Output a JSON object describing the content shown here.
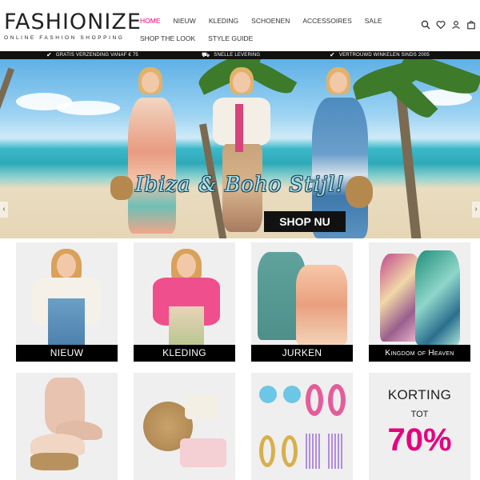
{
  "header": {
    "logo_main": "FASHIONIZE",
    "logo_sub": "ONLINE FASHION SHOPPING",
    "nav_row1": [
      "HOME",
      "NIEUW",
      "KLEDING",
      "SCHOENEN",
      "ACCESSOIRES",
      "SALE"
    ],
    "nav_row2": [
      "SHOP THE LOOK",
      "STYLE GUIDE"
    ],
    "active_item": "HOME",
    "icons": [
      "search-icon",
      "heart-icon",
      "user-icon",
      "bag-icon"
    ],
    "accent_color": "#e6007e"
  },
  "usp_bar": {
    "items": [
      {
        "icon": "check-icon",
        "text": "GRATIS VERZENDING vanaf € 75"
      },
      {
        "icon": "truck-icon",
        "text": "SNELLE LEVERING"
      },
      {
        "icon": "check-icon",
        "text": "VERTROUWD WINKELEN sinds 2005"
      }
    ]
  },
  "hero": {
    "title": "Ibiza & Boho Stijl!",
    "cta": "SHOP NU",
    "prev_icon": "chevron-left-icon",
    "next_icon": "chevron-right-icon"
  },
  "categories": [
    {
      "label": "NIEUW"
    },
    {
      "label": "KLEDING"
    },
    {
      "label": "JURKEN"
    },
    {
      "label": "Kingdom of Heaven"
    }
  ],
  "promo": {
    "line1": "KORTING",
    "line2": "TOT",
    "line3": "70%"
  }
}
